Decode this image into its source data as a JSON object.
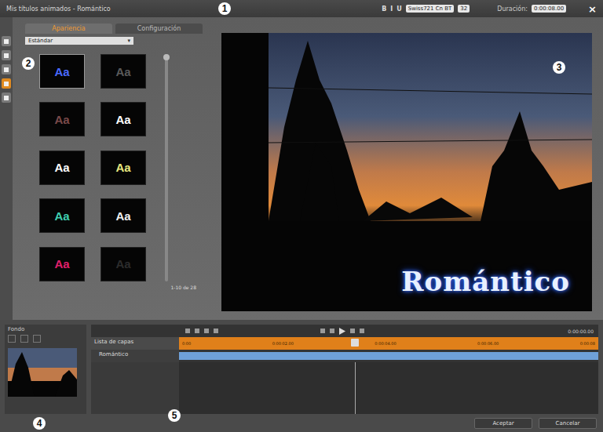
{
  "window": {
    "title": "Mis títulos animados - Romántico",
    "close": "×"
  },
  "callouts": [
    "1",
    "2",
    "3",
    "4",
    "5"
  ],
  "toolbar": {
    "format_buttons": [
      "B",
      "I",
      "U"
    ],
    "font": "Swiss721 Cn BT",
    "size": "32",
    "duration_label": "Duración:",
    "duration": "0:00:08.00"
  },
  "side_tabs": [
    {
      "selected": false
    },
    {
      "selected": false
    },
    {
      "selected": false
    },
    {
      "selected": true
    },
    {
      "selected": false
    }
  ],
  "tabs": [
    {
      "label": "Apariencia",
      "selected": true
    },
    {
      "label": "Configuración",
      "selected": false
    }
  ],
  "category": "Estándar",
  "presets": [
    {
      "label": "Aa",
      "color": "#4a6aff",
      "selected": true
    },
    {
      "label": "Aa",
      "color": "#5a5a5a",
      "selected": false
    },
    {
      "label": "Aa",
      "color": "#7a4a4a",
      "selected": false
    },
    {
      "label": "Aa",
      "color": "#ffffff",
      "selected": false
    },
    {
      "label": "Aa",
      "color": "#ffffff",
      "selected": false
    },
    {
      "label": "Aa",
      "color": "#e8e880",
      "selected": false
    },
    {
      "label": "Aa",
      "color": "#40d0b0",
      "selected": false
    },
    {
      "label": "Aa",
      "color": "#f0f0f0",
      "selected": false
    },
    {
      "label": "Aa",
      "color": "#e0206a",
      "selected": false
    },
    {
      "label": "Aa",
      "color": "#2c2c2c",
      "selected": false
    }
  ],
  "preset_count": "1-10 de 28",
  "preview": {
    "title_text": "Romántico"
  },
  "background": {
    "label": "Fondo"
  },
  "timeline": {
    "layers_label": "Lista de capas",
    "timecode": "0:00:00.00",
    "ruler": [
      "0:00",
      "0:00:02.00",
      "0:00:04.00",
      "0:00:06.00",
      "0:00:08"
    ],
    "playhead_position": 0.42,
    "layers": [
      {
        "name": "Romántico",
        "selected": true
      }
    ]
  },
  "buttons": [
    "Aceptar",
    "Cancelar"
  ]
}
